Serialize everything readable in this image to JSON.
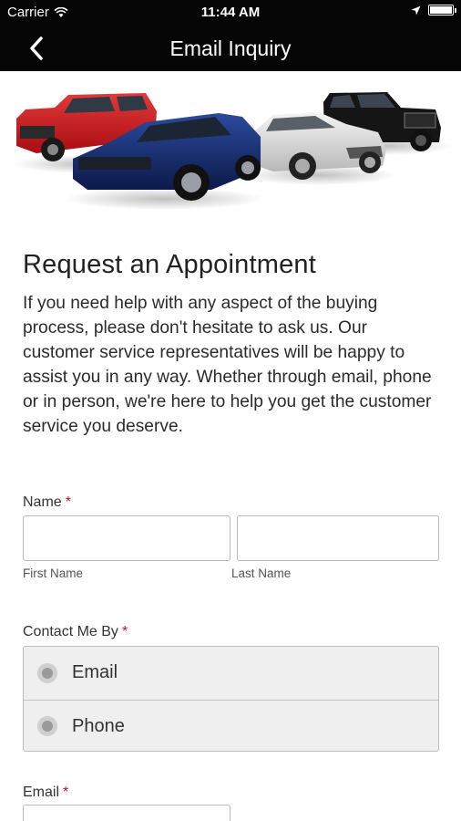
{
  "status_bar": {
    "carrier": "Carrier",
    "time": "11:44 AM"
  },
  "navbar": {
    "title": "Email Inquiry"
  },
  "hero": {
    "alt": "Lineup of vehicles"
  },
  "content": {
    "heading": "Request an Appointment",
    "intro": "If you need help with any aspect of the buying process, please don't hesitate to ask us. Our customer service representatives will be happy to assist you in any way. Whether through email, phone or in person, we're here to help you get the customer service you deserve."
  },
  "form": {
    "name_label": "Name",
    "required_mark": "*",
    "first_name_label": "First Name",
    "last_name_label": "Last Name",
    "contact_label": "Contact Me By",
    "contact_options": [
      "Email",
      "Phone"
    ],
    "email_label": "Email"
  },
  "colors": {
    "header_bg": "#050505",
    "required": "#c8102e",
    "radio_group_bg": "#efefef"
  }
}
